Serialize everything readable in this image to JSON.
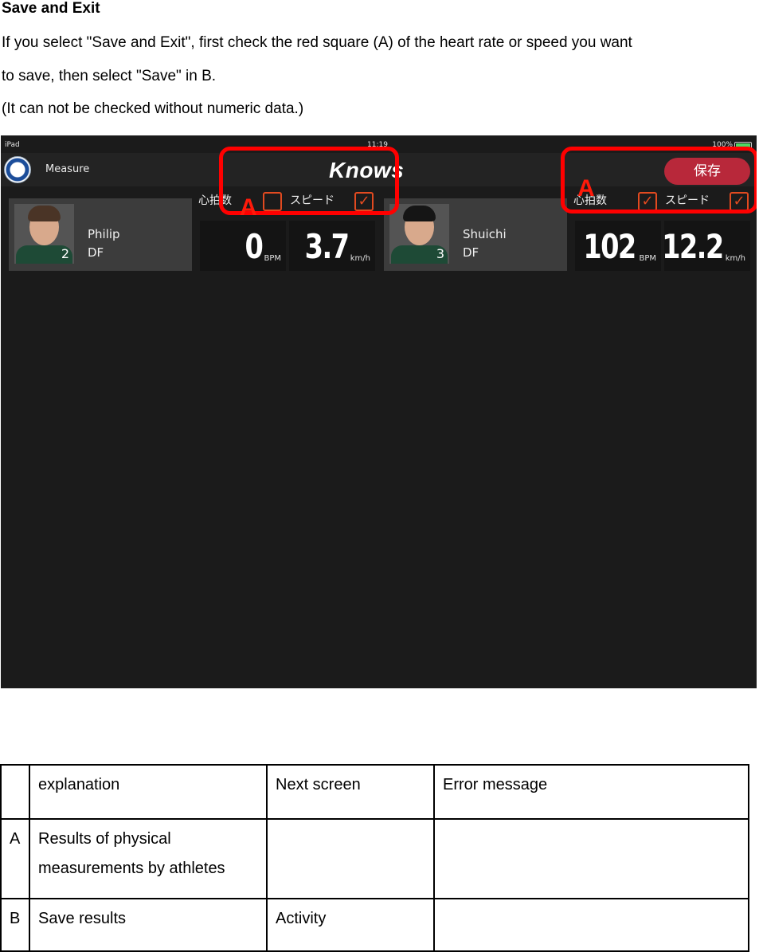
{
  "doc": {
    "title": "Save and Exit",
    "para1": "If you select \"Save and Exit\", first check the red square (A) of the heart rate or speed you want",
    "para2": "to save, then select \"Save\" in B.",
    "para3": "(It can not be checked without numeric data.)"
  },
  "app": {
    "status": {
      "carrier": "iPad",
      "time": "11:19",
      "battery": "100%",
      "battery_level": 1.0
    },
    "nav_title": "Measure",
    "brand": "Knows",
    "save_label": "保存",
    "players": [
      {
        "jersey": "2",
        "name": "Philip",
        "position": "DF",
        "heart_rate_label": "心拍数",
        "speed_label": "スピード",
        "heart_rate": "0",
        "heart_rate_unit": "BPM",
        "speed": "3.7",
        "speed_unit": "km/h",
        "heart_rate_checked": false,
        "speed_checked": true
      },
      {
        "jersey": "3",
        "name": "Shuichi",
        "position": "DF",
        "heart_rate_label": "心拍数",
        "speed_label": "スピード",
        "heart_rate": "102",
        "heart_rate_unit": "BPM",
        "speed": "12.2",
        "speed_unit": "km/h",
        "heart_rate_checked": true,
        "speed_checked": true
      }
    ],
    "annotations": {
      "a1": "A",
      "a2": "A"
    },
    "check_mark": "✓",
    "accent_color": "#e24a20",
    "save_color": "#b8283a"
  },
  "table": {
    "headers": [
      "",
      "explanation",
      "Next screen",
      "Error message"
    ],
    "rows": [
      {
        "key": "A",
        "explanation": "Results of physical measurements by athletes",
        "next": "",
        "error": ""
      },
      {
        "key": "B",
        "explanation": "Save results",
        "next": "Activity",
        "error": ""
      }
    ]
  }
}
